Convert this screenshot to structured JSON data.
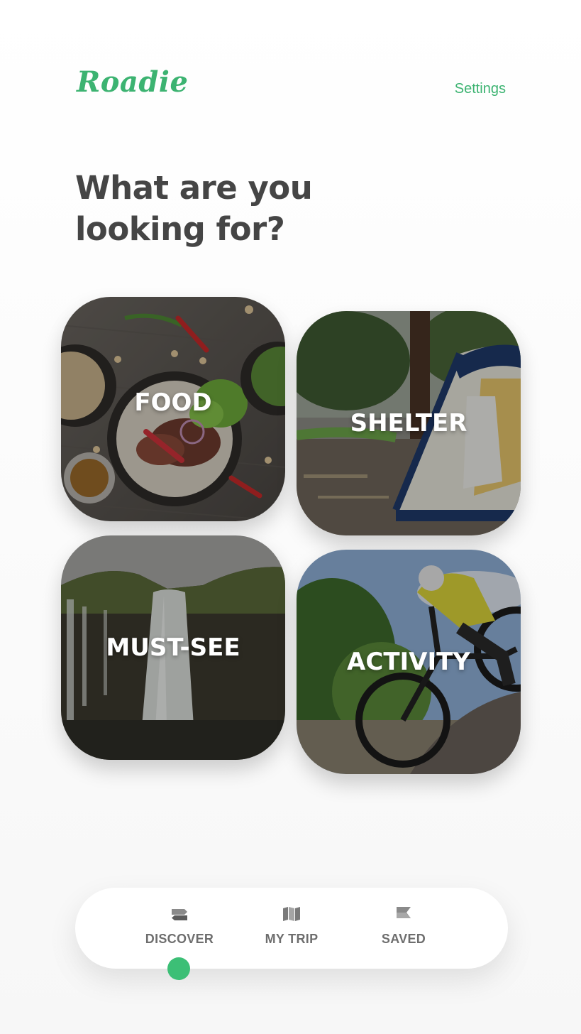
{
  "header": {
    "logo_text": "Roadie",
    "settings_label": "Settings"
  },
  "main": {
    "headline": "What are you looking for?",
    "categories": [
      {
        "label": "FOOD",
        "icon": "food-photo"
      },
      {
        "label": "SHELTER",
        "icon": "tent-photo"
      },
      {
        "label": "MUST-SEE",
        "icon": "waterfall-photo"
      },
      {
        "label": "ACTIVITY",
        "icon": "mountain-bike-photo"
      }
    ]
  },
  "bottom_nav": {
    "items": [
      {
        "label": "DISCOVER",
        "icon": "signpost-icon",
        "active": true
      },
      {
        "label": "MY TRIP",
        "icon": "map-icon",
        "active": false
      },
      {
        "label": "SAVED",
        "icon": "flag-icon",
        "active": false
      }
    ]
  },
  "colors": {
    "accent": "#3cb371",
    "headline": "#454545",
    "nav_label": "#6e6e6e",
    "active_indicator": "#3cbf76"
  }
}
